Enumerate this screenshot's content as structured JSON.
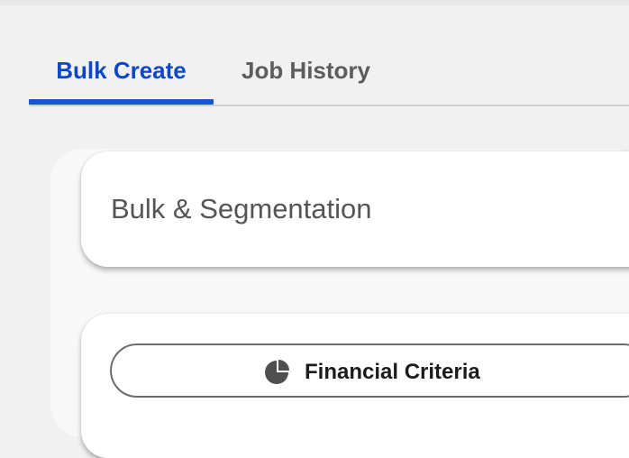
{
  "tabs": [
    {
      "label": "Bulk Create",
      "active": true
    },
    {
      "label": "Job History",
      "active": false
    }
  ],
  "section": {
    "title": "Bulk & Segmentation"
  },
  "filters": {
    "criteria_button_label": "Financial Criteria",
    "criteria_icon": "pie-chart-icon"
  },
  "colors": {
    "accent": "#1456d8",
    "active_tab_text": "#0f47c9",
    "inactive_tab_text": "#5d5d5d"
  }
}
